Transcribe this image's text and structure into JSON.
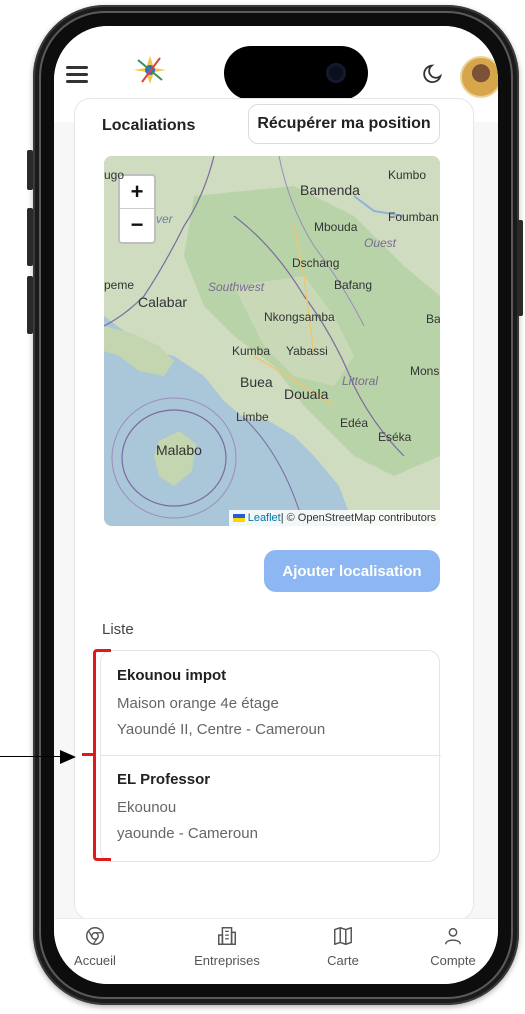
{
  "header": {
    "menu_icon": "menu-icon",
    "logo_icon": "app-logo-icon",
    "theme_icon": "moon-icon",
    "avatar_icon": "user-avatar"
  },
  "locations": {
    "title": "Localiations",
    "get_position_label": "Récupérer ma position",
    "add_location_label": "Ajouter localisation"
  },
  "map": {
    "zoom_in": "+",
    "zoom_out": "−",
    "attribution_leaflet": "Leaflet",
    "attribution_rest": " | © OpenStreetMap contributors",
    "places": {
      "kumbo": "Kumbo",
      "bamenda": "Bamenda",
      "foumban": "Foumban",
      "mbouda": "Mbouda",
      "ouest": "Ouest",
      "dschang": "Dschang",
      "bafang": "Bafang",
      "southwest": "Southwest",
      "calabar": "Calabar",
      "nkongsamba": "Nkongsamba",
      "kumba": "Kumba",
      "yabassi": "Yabassi",
      "littoral": "Littoral",
      "buea": "Buea",
      "douala": "Douala",
      "limbe": "Limbe",
      "edea": "Edéa",
      "eseka": "Eséka",
      "malabo": "Malabo",
      "ba": "Ba",
      "mons": "Mons",
      "ver": "ver",
      "epeme": "peme",
      "ugo": "ugo"
    },
    "colors": {
      "sea": "#a9c7d8",
      "land": "#cfdcc0",
      "forest": "#b9d3a8",
      "border": "#7b6aa0"
    }
  },
  "list": {
    "title": "Liste",
    "items": [
      {
        "name": "Ekounou impot",
        "line1": "Maison orange 4e étage",
        "line2": "Yaoundé II, Centre - Cameroun"
      },
      {
        "name": "EL Professor",
        "line1": "Ekounou",
        "line2": "yaounde - Cameroun"
      }
    ]
  },
  "nav": {
    "items": [
      {
        "label": "Accueil",
        "icon": "home-icon"
      },
      {
        "label": "Entreprises",
        "icon": "building-icon"
      },
      {
        "label": "Carte",
        "icon": "map-icon"
      },
      {
        "label": "Compte",
        "icon": "user-icon"
      }
    ]
  },
  "colors": {
    "primary_button": "#8cb7f3",
    "annotation": "#e01a1a"
  }
}
